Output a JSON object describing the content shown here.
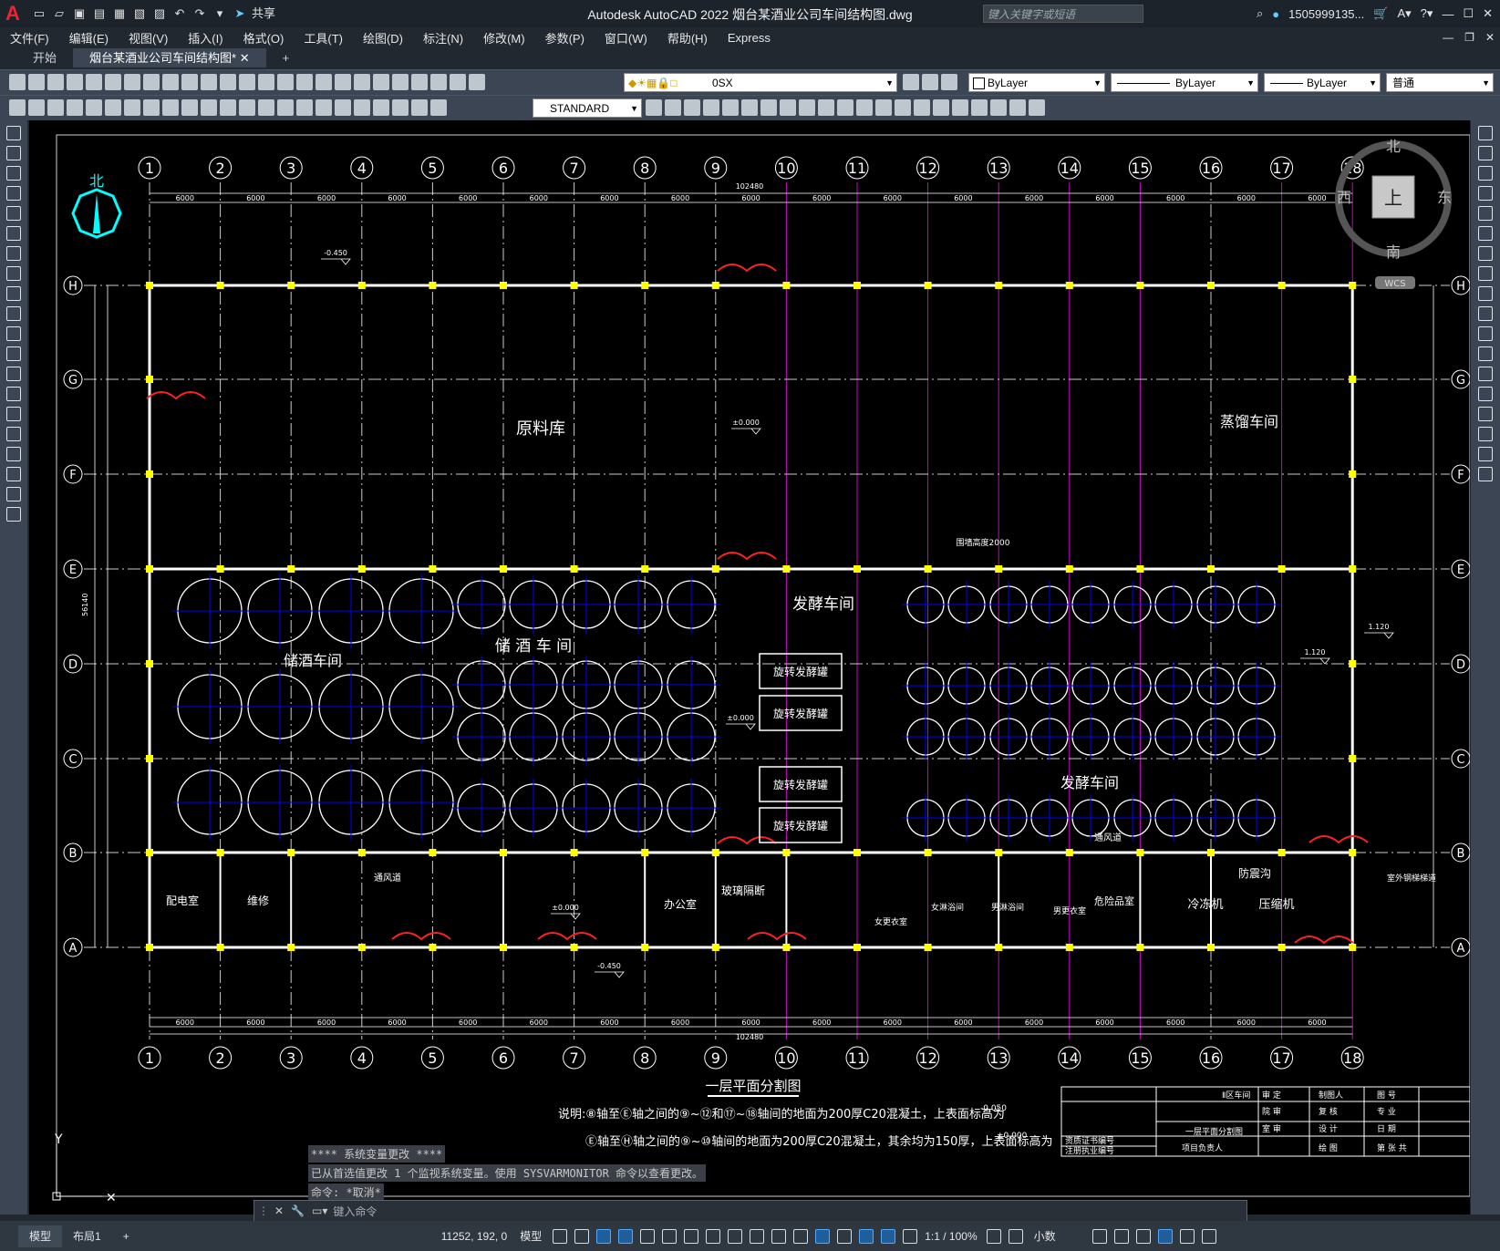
{
  "app": {
    "title": "Autodesk AutoCAD 2022    烟台某酒业公司车间结构图.dwg",
    "search_placeholder": "键入关键字或短语",
    "user": "1505999135...",
    "logo": "A",
    "share": "共享"
  },
  "menus": [
    "文件(F)",
    "编辑(E)",
    "视图(V)",
    "插入(I)",
    "格式(O)",
    "工具(T)",
    "绘图(D)",
    "标注(N)",
    "修改(M)",
    "参数(P)",
    "窗口(W)",
    "帮助(H)",
    "Express"
  ],
  "tabs": [
    {
      "label": "开始"
    },
    {
      "label": "烟台某酒业公司车间结构图*"
    },
    {
      "label": "+"
    }
  ],
  "toolbar": {
    "layer": "0SX",
    "color": "ByLayer",
    "linetype": "ByLayer",
    "lineweight": "ByLayer",
    "plotstyle": "普通",
    "textstyle": "STANDARD"
  },
  "viewcube": {
    "north": "北",
    "south": "南",
    "east": "东",
    "west": "西",
    "top": "上",
    "wcs": "WCS"
  },
  "north_arrow": "北",
  "axes": {
    "numbers": [
      "1",
      "2",
      "3",
      "4",
      "5",
      "6",
      "7",
      "8",
      "9",
      "10",
      "11",
      "12",
      "13",
      "14",
      "15",
      "16",
      "17",
      "18"
    ],
    "letters": [
      "H",
      "G",
      "F",
      "E",
      "D",
      "C",
      "B",
      "A"
    ]
  },
  "rooms": {
    "raw_material": "原料库",
    "distill": "蒸馏车间",
    "ferment_top": "发酵车间",
    "storage1": "储酒车间",
    "storage2": "储 酒 车 间",
    "ferment_right": "发酵车间",
    "tank": "旋转发酵罐",
    "power": "配电室",
    "repair": "维修",
    "vent1": "通风道",
    "office": "办公室",
    "glass": "玻璃隔断",
    "danger": "危险品室",
    "fridge": "冷冻机",
    "compressor": "压缩机",
    "quake": "防震沟",
    "vent2": "通风道",
    "wall_height": "围墙高度2000",
    "female_locker": "女更衣室",
    "female_bath": "女淋浴间",
    "male_bath": "男淋浴间",
    "male_locker": "男更衣室",
    "outdoor_stair": "室外钢梯梯道"
  },
  "dims": {
    "total": "102480",
    "bay": "6000",
    "side": "56140",
    "level_0": "±0.000",
    "level_m": "-0.450",
    "level_1120": "1.120"
  },
  "plan_title": "一层平面分割图",
  "notes": {
    "n1": "说明:⑧轴至Ⓔ轴之间的⑨~⑫和⑰~⑱轴间的地面为200厚C20混凝土，上表面标高为",
    "n1_level": "-0.050",
    "n2": "Ⓔ轴至Ⓗ轴之间的⑨~⑩轴间的地面为200厚C20混凝土，其余均为150厚，上表面标高为",
    "n2_level": "±0.000"
  },
  "titleblock": {
    "area": "Ⅱ区车间",
    "review": "审 定",
    "project_lead": "制图人",
    "drawing_no": "图 号",
    "approve": "院 审",
    "check": "复 核",
    "major": "专 业",
    "office_review": "室 审",
    "design": "设 计",
    "date": "日 期",
    "name": "一层平面分割图",
    "contractor": "资质证书编号",
    "reg": "注册执业编号",
    "owner": "项目负责人",
    "draw": "绘 图",
    "sheet": "第 张 共"
  },
  "command": {
    "history1": "**** 系统变量更改 ****",
    "history2": "已从首选值更改 1 个监视系统变量。使用 SYSVARMONITOR 命令以查看更改。",
    "history3": "命令: *取消*",
    "placeholder": "键入命令"
  },
  "status": {
    "tabs": [
      "模型",
      "布局1",
      "+"
    ],
    "coords": "11252, 192, 0",
    "model": "模型",
    "scale": "1:1 / 100%",
    "units": "小数"
  }
}
